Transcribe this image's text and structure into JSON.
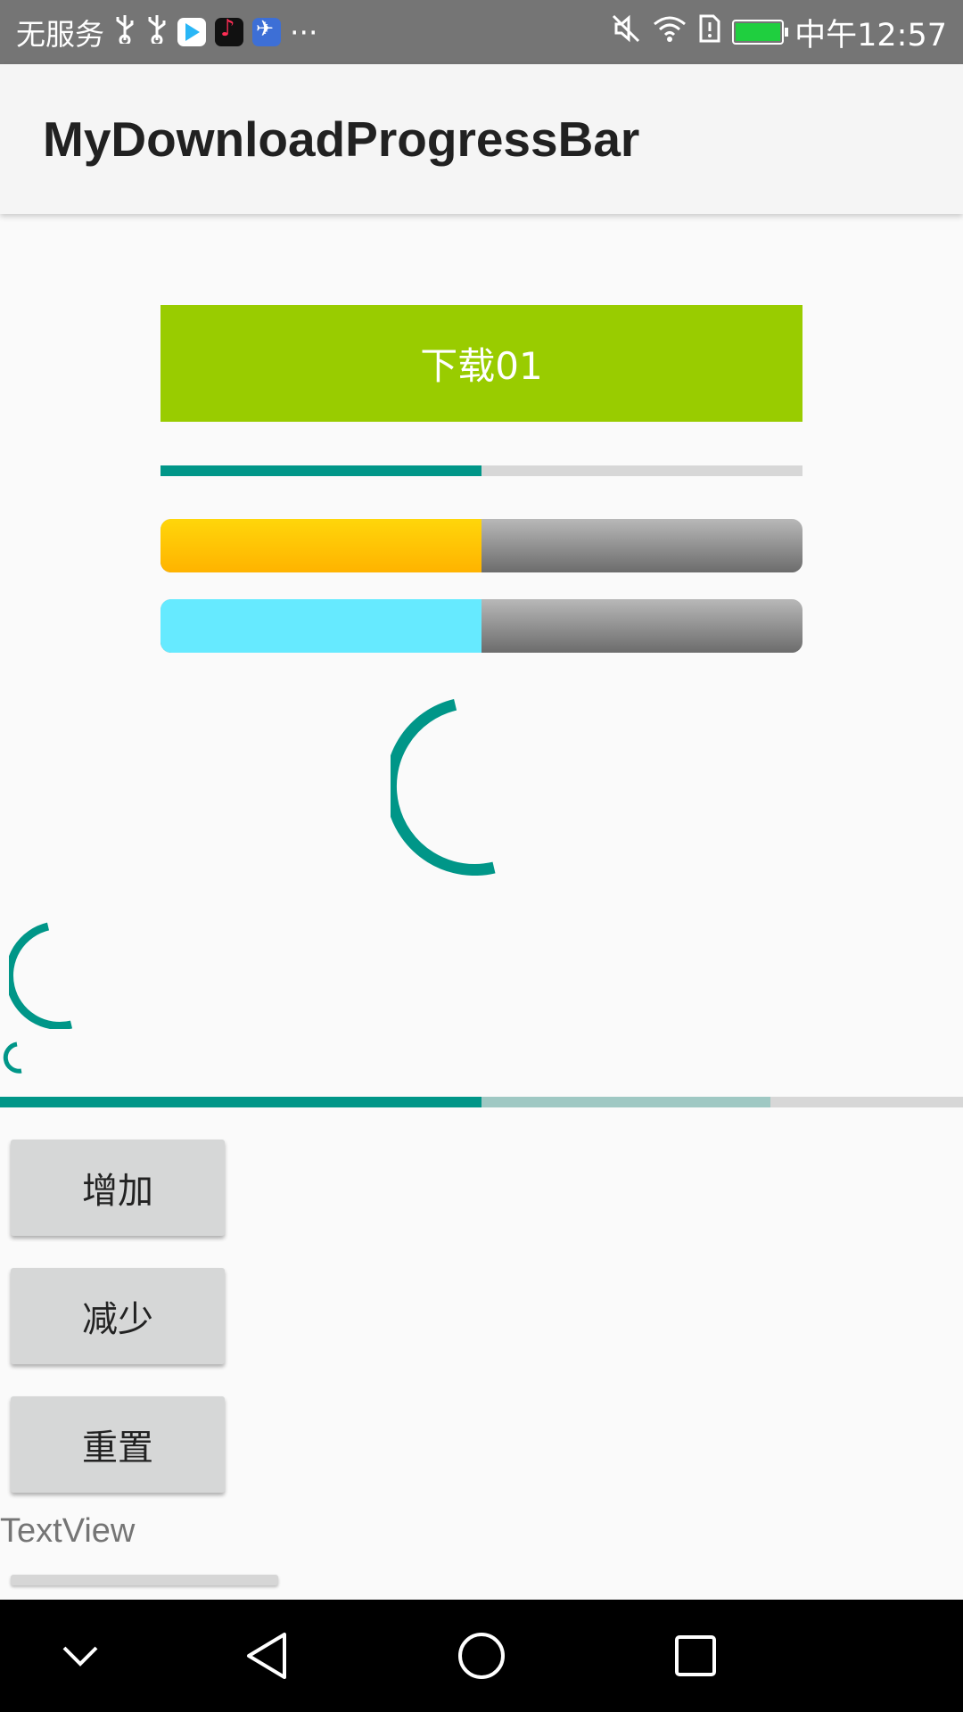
{
  "status_bar": {
    "carrier": "无服务",
    "more": "···",
    "time": "中午12:57",
    "icons": [
      "usb-icon",
      "usb-icon",
      "video-app-icon",
      "tiktok-app-icon",
      "bird-app-icon",
      "mute-icon",
      "wifi-icon",
      "sim-alert-icon",
      "battery-charging-icon"
    ]
  },
  "app_bar": {
    "title": "MyDownloadProgressBar"
  },
  "download_button": {
    "label": "下载01",
    "color": "#99cc00"
  },
  "progress": {
    "thin_bar": 0.5,
    "yellow_bar": 0.5,
    "cyan_bar": 0.5,
    "wide_bar_primary": 0.5,
    "wide_bar_secondary": 0.8
  },
  "colors": {
    "accent": "#009688",
    "yellow": "#ffc107",
    "cyan": "#66eaff"
  },
  "buttons": {
    "add": "增加",
    "subtract": "减少",
    "reset": "重置"
  },
  "textview": "TextView",
  "nav_bar": {
    "icons": [
      "chevron-down-icon",
      "back-icon",
      "home-icon",
      "recents-icon"
    ]
  }
}
